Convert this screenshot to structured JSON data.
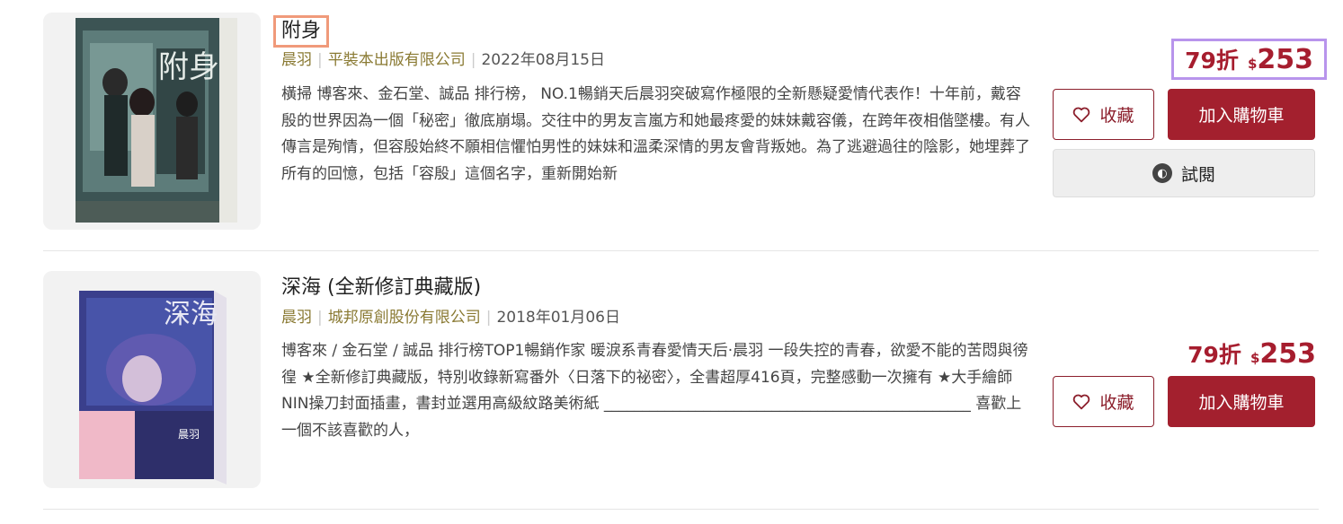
{
  "items": [
    {
      "title": "附身",
      "author": "晨羽",
      "publisher": "平裝本出版有限公司",
      "date": "2022年08月15日",
      "description": "橫掃 博客來、金石堂、誠品 排行榜， NO.1暢銷天后晨羽突破寫作極限的全新懸疑愛情代表作！十年前，戴容殷的世界因為一個「秘密」徹底崩塌。交往中的男友言嵐方和她最疼愛的妹妹戴容儀，在跨年夜相偕墜樓。有人傳言是殉情，但容殷始終不願相信懼怕男性的妹妹和溫柔深情的男友會背叛她。為了逃避過往的陰影，她埋葬了所有的回憶，包括「容殷」這個名字，重新開始新",
      "discount": "79折",
      "currency": "$",
      "price": "253",
      "fav_label": "收藏",
      "cart_label": "加入購物車",
      "trial_label": "試閱",
      "cover_title": "附身"
    },
    {
      "title": "深海 (全新修訂典藏版)",
      "author": "晨羽",
      "publisher": "城邦原創股份有限公司",
      "date": "2018年01月06日",
      "description": "博客來 / 金石堂 / 誠品 排行榜TOP1暢銷作家 暖淚系青春愛情天后·晨羽 一段失控的青春，欲愛不能的苦悶與徬徨 ★全新修訂典藏版，特別收錄新寫番外〈日落下的祕密〉，全書超厚416頁，完整感動一次擁有 ★大手繪師NIN操刀封面插畫，書封並選用高級紋路美術紙 ________________________________________________ 喜歡上一個不該喜歡的人，",
      "discount": "79折",
      "currency": "$",
      "price": "253",
      "fav_label": "收藏",
      "cart_label": "加入購物車",
      "cover_title": "深海",
      "cover_author": "晨羽"
    }
  ],
  "colors": {
    "accent": "#a3202e",
    "publisher_text": "#8a7a33",
    "highlight_title": "#f09a7a",
    "highlight_price": "#b894ec"
  }
}
